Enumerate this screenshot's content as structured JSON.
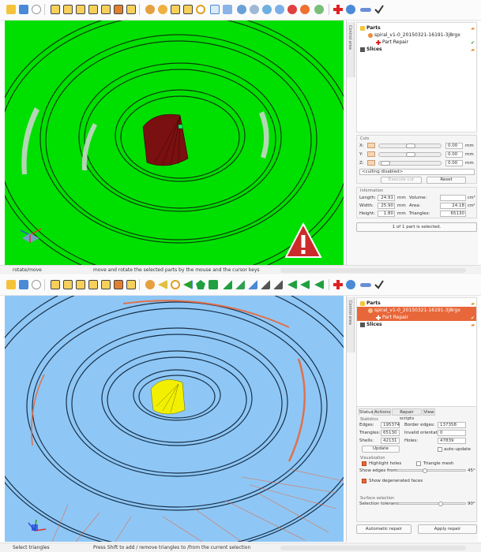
{
  "top": {
    "tree": {
      "root_label": "Parts",
      "part_name": "spiral_v1-0_20150321-16191-3j8rgx",
      "repair_label": "Part Repair",
      "slices_label": "Slices"
    },
    "cuts": {
      "section_label": "Cuts",
      "axes": [
        {
          "label": "X:",
          "value": "0.00",
          "unit": "mm"
        },
        {
          "label": "Y:",
          "value": "0.00",
          "unit": "mm"
        },
        {
          "label": "Z:",
          "value": "0.00",
          "unit": "mm"
        }
      ],
      "culling_select": "<culling disabled>",
      "execute_label": "Execute cut",
      "reset_label": "Reset"
    },
    "info": {
      "section_label": "Information",
      "length_label": "Length:",
      "length_value": "24.91",
      "length_unit": "mm",
      "volume_label": "Volume:",
      "volume_value": "",
      "volume_unit": "cm³",
      "width_label": "Width:",
      "width_value": "25.90",
      "width_unit": "mm",
      "area_label": "Area:",
      "area_value": "24.18",
      "area_unit": "cm²",
      "height_label": "Height:",
      "height_value": "1.80",
      "height_unit": "mm",
      "triangles_label": "Triangles:",
      "triangles_value": "65130"
    },
    "selection_status": "1 of 1 part is selected.",
    "sidebar_tab": "Control area",
    "status": {
      "mode": "rotate/move",
      "help": "move and rotate the selected parts by the mouse and the cursor keys"
    }
  },
  "bottom": {
    "tree": {
      "root_label": "Parts",
      "part_name": "spiral_v1-0_20150321-16191-3j8rgx",
      "repair_label": "Part Repair",
      "slices_label": "Slices"
    },
    "tabs": [
      "Status",
      "Actions",
      "Repair scripts",
      "View"
    ],
    "statistics": {
      "section_label": "Statistics",
      "edges_label": "Edges:",
      "edges_value": "195374",
      "border_label": "Border edges:",
      "border_value": "137358",
      "triangles_label": "Triangles:",
      "triangles_value": "65130",
      "invalid_label": "Invalid orientation:",
      "invalid_value": "0",
      "shells_label": "Shells:",
      "shells_value": "42131",
      "holes_label": "Holes:",
      "holes_value": "47839",
      "update_label": "Update",
      "auto_update_label": "auto-update"
    },
    "visualization": {
      "section_label": "Visualization",
      "highlight_holes_label": "Highlight holes",
      "triangle_mesh_label": "Triangle mesh",
      "show_edges_label": "Show edges from",
      "show_edges_value": "45°",
      "show_degenerated_label": "Show degenerated faces"
    },
    "surface": {
      "section_label": "Surface selection",
      "tolerance_label": "Selection tolerance",
      "tolerance_value": "90°"
    },
    "automatic_repair_label": "Automatic repair",
    "apply_repair_label": "Apply repair",
    "sidebar_tab": "Control area",
    "status": {
      "mode": "Select triangles",
      "help": "Press Shift to add / remove triangles to /from the current selection"
    }
  },
  "colors": {
    "green_bg": "#00e000",
    "blue_bg": "#8ec7f5",
    "highlight": "#e8673a",
    "hole_dark": "#7a1010",
    "selected_yellow": "#f2f000",
    "warning_red": "#cc2b2b"
  },
  "icons": {
    "warning": "warning-triangle-icon",
    "cursor": "arrow-cursor-icon",
    "repair": "red-cross-icon",
    "ok": "green-check-icon"
  }
}
